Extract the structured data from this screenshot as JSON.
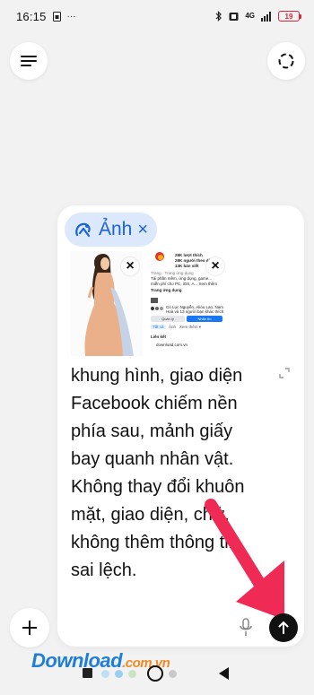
{
  "status_bar": {
    "time": "16:15",
    "left_icons": [
      "sim-icon",
      "more-dots-icon"
    ],
    "more": "···",
    "network": "4G",
    "battery": "19",
    "right_icons": [
      "bluetooth-icon",
      "vibrate-icon",
      "signal-icon",
      "battery-icon"
    ]
  },
  "top_buttons": {
    "menu_icon": "menu-lines-icon",
    "capture_icon": "screen-capture-icon"
  },
  "attachment_tag": {
    "label": "Ảnh",
    "close": "×",
    "icon": "image-sparkle-icon"
  },
  "thumbnails": [
    {
      "name": "photo-thumbnail",
      "close": "×"
    },
    {
      "name": "screenshot-thumbnail",
      "close": "×"
    }
  ],
  "screenshot_thumb": {
    "likes": "28K lượt thích",
    "followers": "28K người theo dõi",
    "talk": "13K bàn viết",
    "page_type": "Trang · Trang ứng dụng",
    "desc1": "Tải phần mềm, ứng dụng, game...",
    "desc2": "miễn phí cho PC, iOS, A... Xem thêm",
    "section": "Trang ứng dụng",
    "friends1": "Có Lục Nguyễn, Alióu Lao, Nam",
    "friends2": "Hoà và 13 người bạn khác thích",
    "manage": "Quản lý",
    "message": "Nhắn tin",
    "tab_posts": "Tất cả",
    "tab_photos": "Ảnh",
    "tab_more": "Xem thêm ▾",
    "links_label": "Liên kết",
    "link": "download.com.vn"
  },
  "prompt_text": "khung hình, giao diện Facebook chiếm nền phía sau, mảnh giấy bay quanh nhân vật. Không thay đổi khuôn mặt, giao diện, chữ, không thêm thông tin sai lệch.",
  "controls": {
    "plus": "+",
    "expand_icon": "expand-icon",
    "mic_icon": "microphone-icon",
    "send_icon": "send-arrow-up-icon"
  },
  "watermark": {
    "main": "Download",
    "sub": ".com.vn"
  },
  "nav_dots": [
    "#bde0f4",
    "#9ad0ef",
    "#c6e6c3",
    "#c9c9c9"
  ],
  "colors": {
    "tag_bg": "#dce8fb",
    "tag_fg": "#1a63d8",
    "arrow": "#ee2a55",
    "send_bg": "#111111",
    "battery": "#d9263d"
  }
}
